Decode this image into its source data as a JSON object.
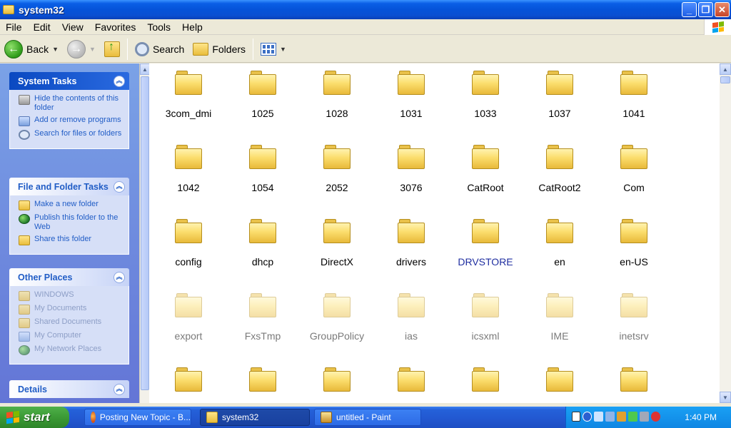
{
  "window": {
    "title": "system32"
  },
  "menu": {
    "items": [
      "File",
      "Edit",
      "View",
      "Favorites",
      "Tools",
      "Help"
    ]
  },
  "toolbar": {
    "back_label": "Back",
    "search_label": "Search",
    "folders_label": "Folders"
  },
  "task_pane": {
    "system_tasks": {
      "title": "System Tasks",
      "items": [
        "Hide the contents of this folder",
        "Add or remove programs",
        "Search for files or folders"
      ]
    },
    "file_folder_tasks": {
      "title": "File and Folder Tasks",
      "items": [
        "Make a new folder",
        "Publish this folder to the Web",
        "Share this folder"
      ]
    },
    "other_places": {
      "title": "Other Places",
      "items": [
        "WINDOWS",
        "My Documents",
        "Shared Documents",
        "My Computer",
        "My Network Places"
      ]
    },
    "details": {
      "title": "Details"
    }
  },
  "folders": [
    {
      "name": "3com_dmi",
      "state": "normal"
    },
    {
      "name": "1025",
      "state": "normal"
    },
    {
      "name": "1028",
      "state": "normal"
    },
    {
      "name": "1031",
      "state": "normal"
    },
    {
      "name": "1033",
      "state": "normal"
    },
    {
      "name": "1037",
      "state": "normal"
    },
    {
      "name": "1041",
      "state": "normal"
    },
    {
      "name": "1042",
      "state": "normal"
    },
    {
      "name": "1054",
      "state": "normal"
    },
    {
      "name": "2052",
      "state": "normal"
    },
    {
      "name": "3076",
      "state": "normal"
    },
    {
      "name": "CatRoot",
      "state": "normal"
    },
    {
      "name": "CatRoot2",
      "state": "normal"
    },
    {
      "name": "Com",
      "state": "normal"
    },
    {
      "name": "config",
      "state": "normal"
    },
    {
      "name": "dhcp",
      "state": "normal"
    },
    {
      "name": "DirectX",
      "state": "normal"
    },
    {
      "name": "drivers",
      "state": "normal"
    },
    {
      "name": "DRVSTORE",
      "state": "compressed"
    },
    {
      "name": "en",
      "state": "normal"
    },
    {
      "name": "en-US",
      "state": "normal"
    },
    {
      "name": "export",
      "state": "hidden"
    },
    {
      "name": "FxsTmp",
      "state": "hidden"
    },
    {
      "name": "GroupPolicy",
      "state": "hidden"
    },
    {
      "name": "ias",
      "state": "hidden"
    },
    {
      "name": "icsxml",
      "state": "hidden"
    },
    {
      "name": "IME",
      "state": "hidden"
    },
    {
      "name": "inetsrv",
      "state": "hidden"
    },
    {
      "name": "",
      "state": "normal"
    },
    {
      "name": "",
      "state": "normal"
    },
    {
      "name": "",
      "state": "normal"
    },
    {
      "name": "",
      "state": "normal"
    },
    {
      "name": "",
      "state": "normal"
    },
    {
      "name": "",
      "state": "normal"
    },
    {
      "name": "",
      "state": "normal"
    }
  ],
  "taskbar": {
    "start_label": "start",
    "tasks": [
      {
        "label": "Posting New Topic - B...",
        "icon": "firefox-icon",
        "active": false
      },
      {
        "label": "system32",
        "icon": "folder-icon",
        "active": true
      },
      {
        "label": "untitled - Paint",
        "icon": "paint-icon",
        "active": false
      }
    ],
    "clock": "1:40 PM"
  },
  "colors": {
    "titlebar": "#0553d9",
    "taskpane": "#7ba2e7",
    "link": "#215dc6",
    "start": "#3b9a35"
  }
}
